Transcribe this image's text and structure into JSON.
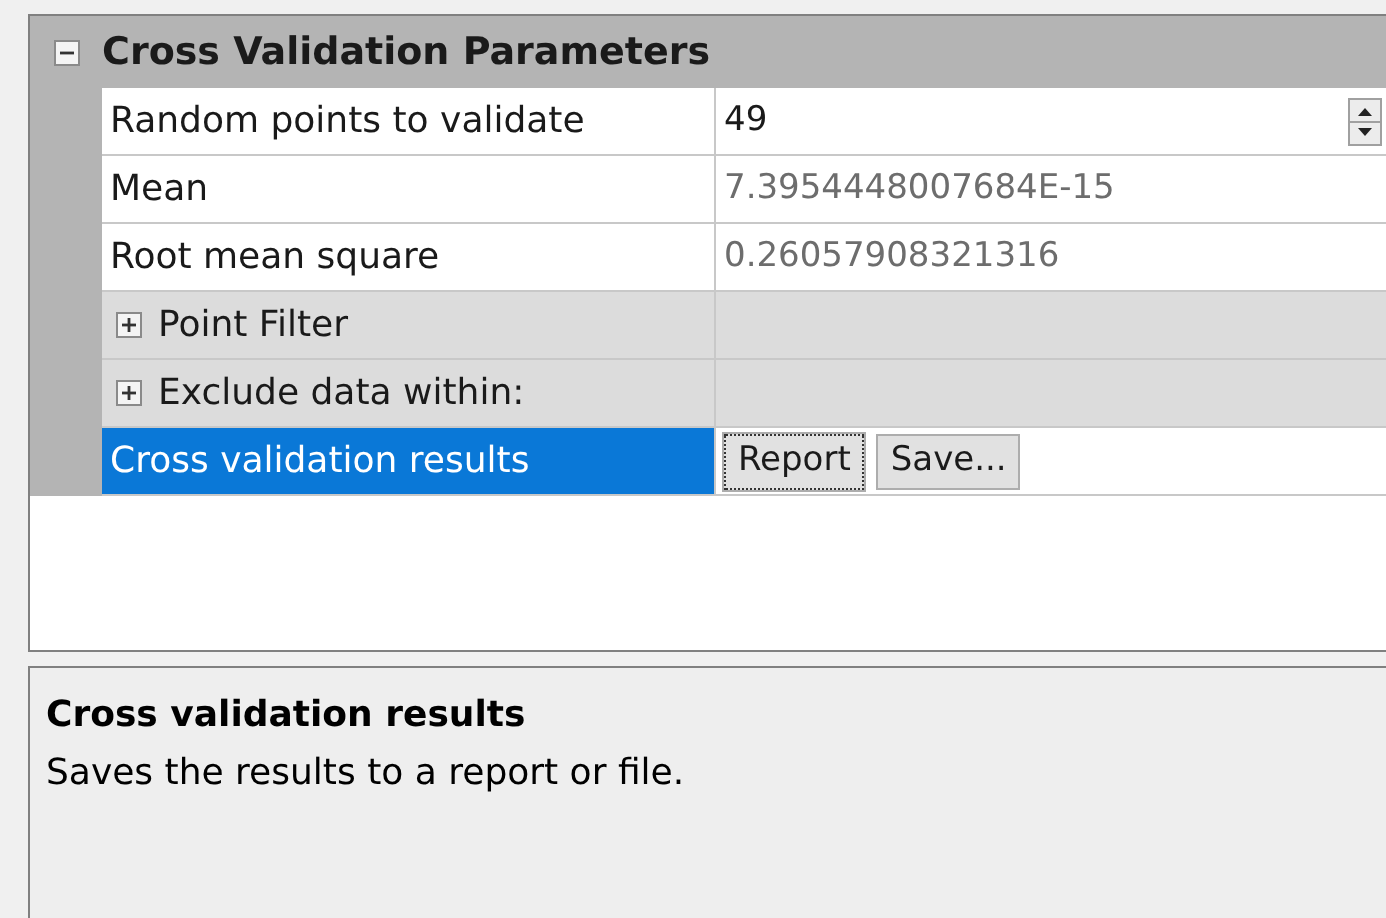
{
  "section": {
    "title": "Cross Validation Parameters",
    "expanded": true
  },
  "rows": [
    {
      "kind": "spin",
      "label": "Random points to validate",
      "value": "49",
      "selected": false
    },
    {
      "kind": "readonly",
      "label": "Mean",
      "value": "7.3954448007684E-15",
      "selected": false
    },
    {
      "kind": "readonly",
      "label": "Root mean square",
      "value": "0.26057908321316",
      "selected": false
    },
    {
      "kind": "group",
      "label": "Point Filter",
      "expanded": false,
      "selected": false
    },
    {
      "kind": "group",
      "label": "Exclude data within:",
      "expanded": false,
      "selected": false
    },
    {
      "kind": "buttons",
      "label": "Cross validation results",
      "selected": true,
      "buttons": [
        {
          "label": "Report",
          "focused": true
        },
        {
          "label": "Save...",
          "focused": false
        }
      ]
    }
  ],
  "help": {
    "title": "Cross validation results",
    "text": "Saves the results to a report or file."
  }
}
